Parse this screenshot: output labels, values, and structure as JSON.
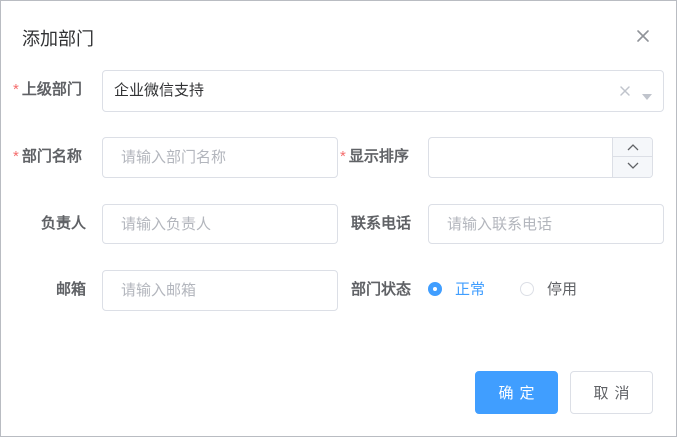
{
  "dialog": {
    "title": "添加部门",
    "close_icon": "close-icon"
  },
  "colors": {
    "primary": "#409eff",
    "required": "#f56c6c",
    "border": "#dcdfe6",
    "placeholder": "#b3b6bd"
  },
  "form": {
    "parent": {
      "label": "上级部门",
      "required_mark": "*",
      "value": "企业微信支持"
    },
    "dept_name": {
      "label": "部门名称",
      "required_mark": "*",
      "value": "",
      "placeholder": "请输入部门名称"
    },
    "order": {
      "label": "显示排序",
      "required_mark": "*",
      "value": ""
    },
    "leader": {
      "label": "负责人",
      "value": "",
      "placeholder": "请输入负责人"
    },
    "phone": {
      "label": "联系电话",
      "value": "",
      "placeholder": "请输入联系电话"
    },
    "email": {
      "label": "邮箱",
      "value": "",
      "placeholder": "请输入邮箱"
    },
    "status": {
      "label": "部门状态",
      "options": [
        {
          "label": "正常",
          "checked": true
        },
        {
          "label": "停用",
          "checked": false
        }
      ]
    }
  },
  "footer": {
    "confirm_label": "确定",
    "cancel_label": "取消"
  }
}
